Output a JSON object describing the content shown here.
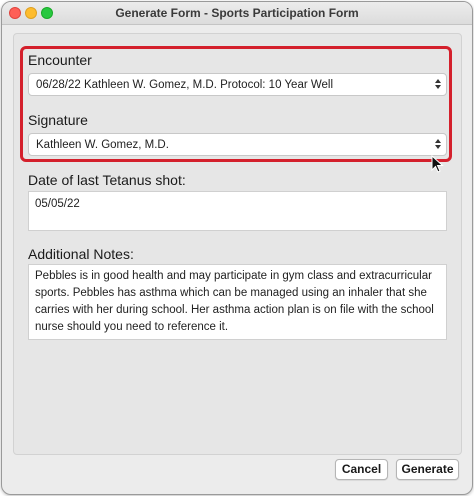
{
  "window": {
    "title": "Generate Form - Sports Participation Form"
  },
  "form": {
    "encounter_label": "Encounter",
    "encounter_value": "06/28/22 Kathleen W. Gomez, M.D. Protocol: 10 Year Well",
    "signature_label": "Signature",
    "signature_value": "Kathleen W. Gomez, M.D.",
    "tetanus_label": "Date of last Tetanus shot:",
    "tetanus_value": "05/05/22",
    "notes_label": "Additional Notes:",
    "notes_value": "Pebbles is in good health and may participate in gym class and extracurricular sports. Pebbles has asthma which can be managed using an inhaler that she carries with her during school. Her asthma action plan is on file with the school nurse should you need to reference it."
  },
  "buttons": {
    "cancel": "Cancel",
    "generate": "Generate"
  },
  "colors": {
    "highlight": "#d4202c"
  },
  "icons": {
    "select_arrows": "up-down-chevron-icon",
    "cursor": "mouse-pointer-icon"
  }
}
